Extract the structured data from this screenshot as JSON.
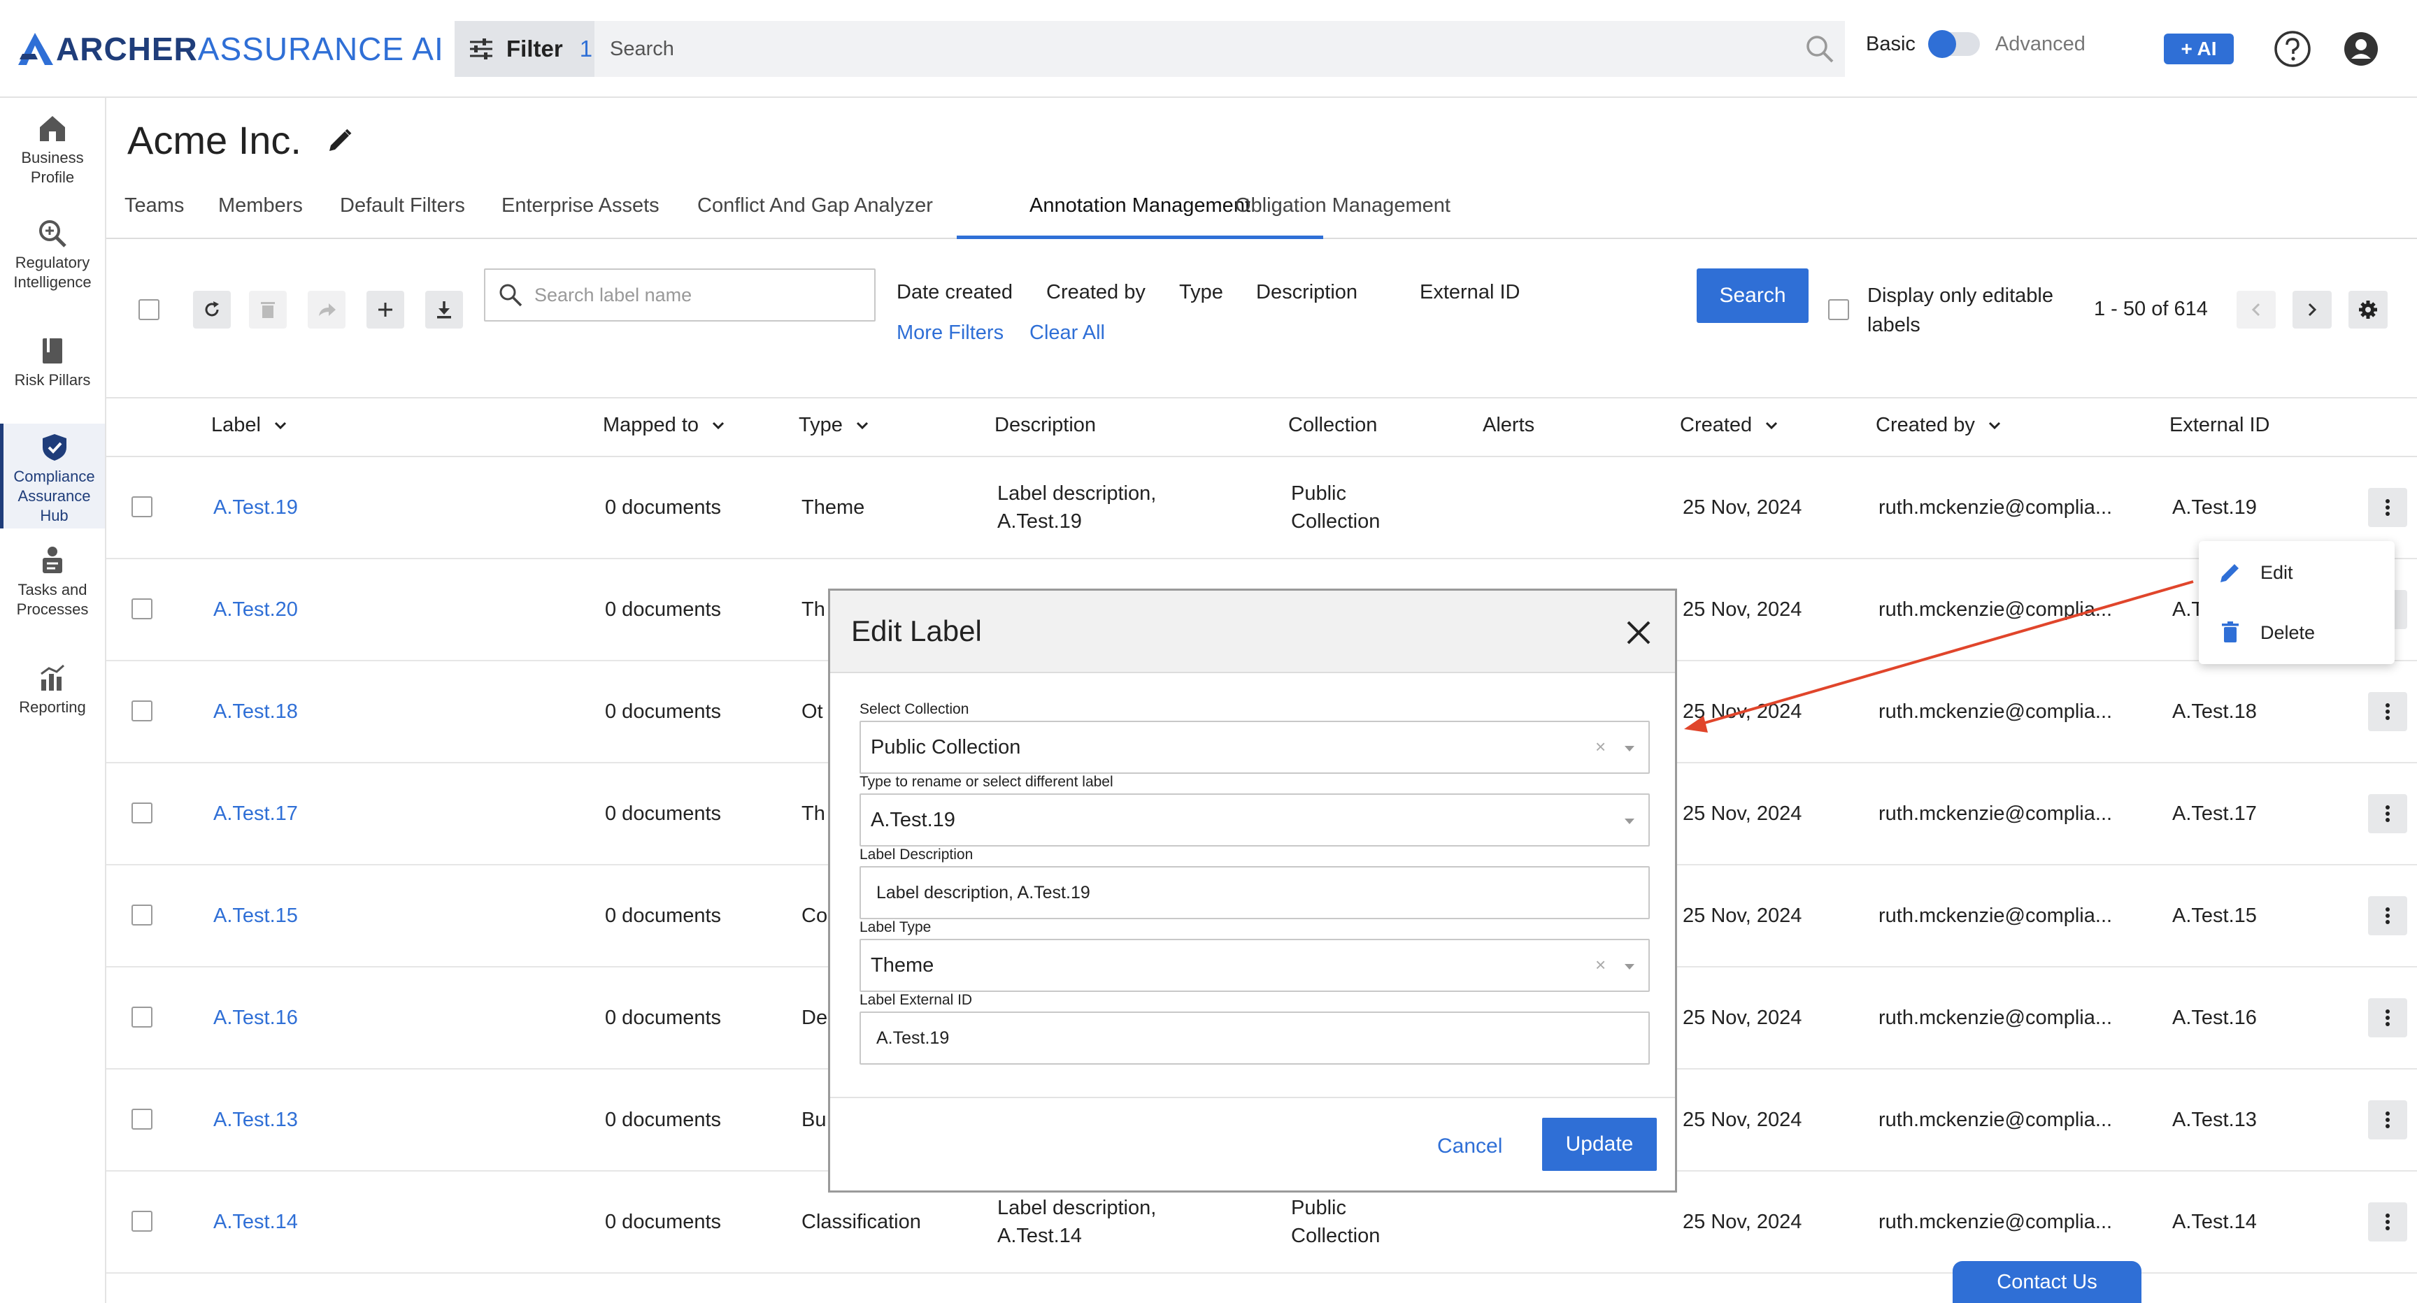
{
  "app": {
    "logo_word1": "ARCHER",
    "logo_word2": "ASSURANCE AI",
    "filter_label": "Filter",
    "filter_count": "1",
    "search_placeholder": "Search",
    "mode_basic": "Basic",
    "mode_advanced": "Advanced",
    "ai_button": "+ AI",
    "accent_color": "#2f6fd6"
  },
  "sidebar": {
    "items": [
      {
        "label": "Business Profile",
        "icon": "home-icon"
      },
      {
        "label": "Regulatory Intelligence",
        "icon": "search-zoom-icon"
      },
      {
        "label": "Risk Pillars",
        "icon": "book-icon"
      },
      {
        "label": "Compliance Assurance Hub",
        "icon": "shield-check-icon",
        "active": true
      },
      {
        "label": "Tasks and Processes",
        "icon": "person-task-icon"
      },
      {
        "label": "Reporting",
        "icon": "chart-icon"
      }
    ]
  },
  "header": {
    "company": "Acme Inc.",
    "tabs": [
      "Teams",
      "Members",
      "Default Filters",
      "Enterprise Assets",
      "Conflict And Gap Analyzer",
      "Annotation Management",
      "Obligation Management"
    ],
    "active_tab": "Annotation Management"
  },
  "toolbar": {
    "search_placeholder": "Search label name",
    "filters": [
      "Date created",
      "Created by",
      "Type",
      "Description",
      "External ID"
    ],
    "more_filters": "More Filters",
    "clear_all": "Clear All",
    "search_button": "Search",
    "editable_line1": "Display only editable",
    "editable_line2": "labels",
    "pagination": "1 - 50 of 614"
  },
  "table": {
    "columns": [
      "Label",
      "Mapped to",
      "Type",
      "Description",
      "Collection",
      "Alerts",
      "Created",
      "Created by",
      "External ID"
    ],
    "rows": [
      {
        "label": "A.Test.19",
        "mapped": "0 documents",
        "type": "Theme",
        "desc1": "Label description,",
        "desc2": "A.Test.19",
        "col1": "Public",
        "col2": "Collection",
        "created": "25 Nov, 2024",
        "by": "ruth.mckenzie@complia...",
        "ext": "A.Test.19"
      },
      {
        "label": "A.Test.20",
        "mapped": "0 documents",
        "type": "Th",
        "created": "25 Nov, 2024",
        "by": "ruth.mckenzie@complia...",
        "ext": "A.T"
      },
      {
        "label": "A.Test.18",
        "mapped": "0 documents",
        "type": "Ot",
        "created": "25 Nov, 2024",
        "by": "ruth.mckenzie@complia...",
        "ext": "A.Test.18"
      },
      {
        "label": "A.Test.17",
        "mapped": "0 documents",
        "type": "Th",
        "created": "25 Nov, 2024",
        "by": "ruth.mckenzie@complia...",
        "ext": "A.Test.17"
      },
      {
        "label": "A.Test.15",
        "mapped": "0 documents",
        "type": "Co",
        "created": "25 Nov, 2024",
        "by": "ruth.mckenzie@complia...",
        "ext": "A.Test.15"
      },
      {
        "label": "A.Test.16",
        "mapped": "0 documents",
        "type": "De",
        "created": "25 Nov, 2024",
        "by": "ruth.mckenzie@complia...",
        "ext": "A.Test.16"
      },
      {
        "label": "A.Test.13",
        "mapped": "0 documents",
        "type": "Bu",
        "created": "25 Nov, 2024",
        "by": "ruth.mckenzie@complia...",
        "ext": "A.Test.13"
      },
      {
        "label": "A.Test.14",
        "mapped": "0 documents",
        "type": "Classification",
        "desc1": "Label description,",
        "desc2": "A.Test.14",
        "col1": "Public",
        "col2": "Collection",
        "created": "25 Nov, 2024",
        "by": "ruth.mckenzie@complia...",
        "ext": "A.Test.14"
      }
    ]
  },
  "context_menu": {
    "edit": "Edit",
    "delete": "Delete"
  },
  "modal": {
    "title": "Edit Label",
    "collection_label": "Select Collection",
    "collection_value": "Public Collection",
    "rename_label": "Type to rename or select different label",
    "rename_value": "A.Test.19",
    "description_label": "Label Description",
    "description_value": "Label description, A.Test.19",
    "type_label": "Label Type",
    "type_value": "Theme",
    "external_id_label": "Label External ID",
    "external_id_value": "A.Test.19",
    "cancel": "Cancel",
    "update": "Update",
    "clear_glyph": "×"
  },
  "footer": {
    "contact": "Contact Us"
  }
}
